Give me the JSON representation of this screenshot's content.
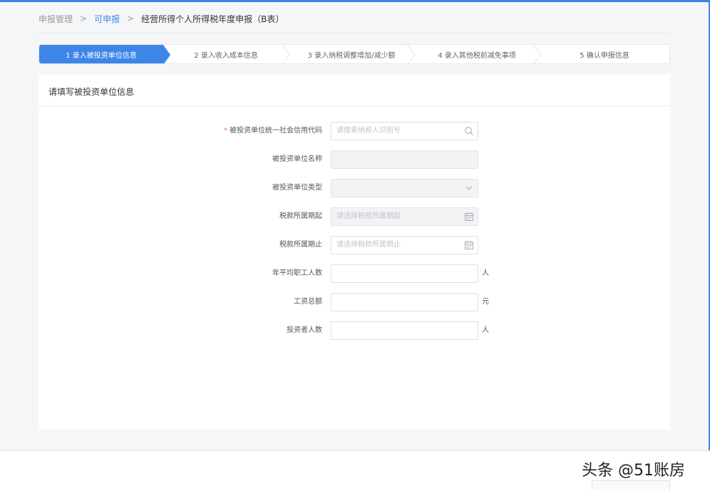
{
  "breadcrumb": {
    "items": [
      "申报管理",
      "可申报",
      "经营所得个人所得税年度申报（B表）"
    ],
    "separator": ">"
  },
  "steps": [
    {
      "label": "1 录入被投资单位信息",
      "active": true
    },
    {
      "label": "2 录入收入成本信息",
      "active": false
    },
    {
      "label": "3 录入纳税调整增加/减少额",
      "active": false
    },
    {
      "label": "4 录入其他税前减免事项",
      "active": false
    },
    {
      "label": "5 确认申报信息",
      "active": false
    }
  ],
  "panel": {
    "title": "请填写被投资单位信息"
  },
  "form": {
    "credit_code": {
      "required_mark": "*",
      "label": "被投资单位统一社会信用代码",
      "placeholder": "请搜索纳税人识别号",
      "icon": "search-icon"
    },
    "unit_name": {
      "label": "被投资单位名称",
      "value": ""
    },
    "unit_type": {
      "label": "被投资单位类型",
      "value": "",
      "icon": "chevron-down-icon"
    },
    "period_start": {
      "label": "税款所属期起",
      "placeholder": "请选择税款所属期起",
      "icon": "calendar-icon"
    },
    "period_end": {
      "label": "税款所属期止",
      "placeholder": "请选择税款所属期止",
      "icon": "calendar-icon"
    },
    "avg_employees": {
      "label": "年平均职工人数",
      "value": "",
      "unit": "人"
    },
    "total_wages": {
      "label": "工资总额",
      "value": "",
      "unit": "元"
    },
    "investors": {
      "label": "投资者人数",
      "value": "",
      "unit": "人"
    }
  },
  "watermark": "头条 @51账房",
  "colors": {
    "accent": "#3d86e8",
    "required": "#f56c6c"
  }
}
